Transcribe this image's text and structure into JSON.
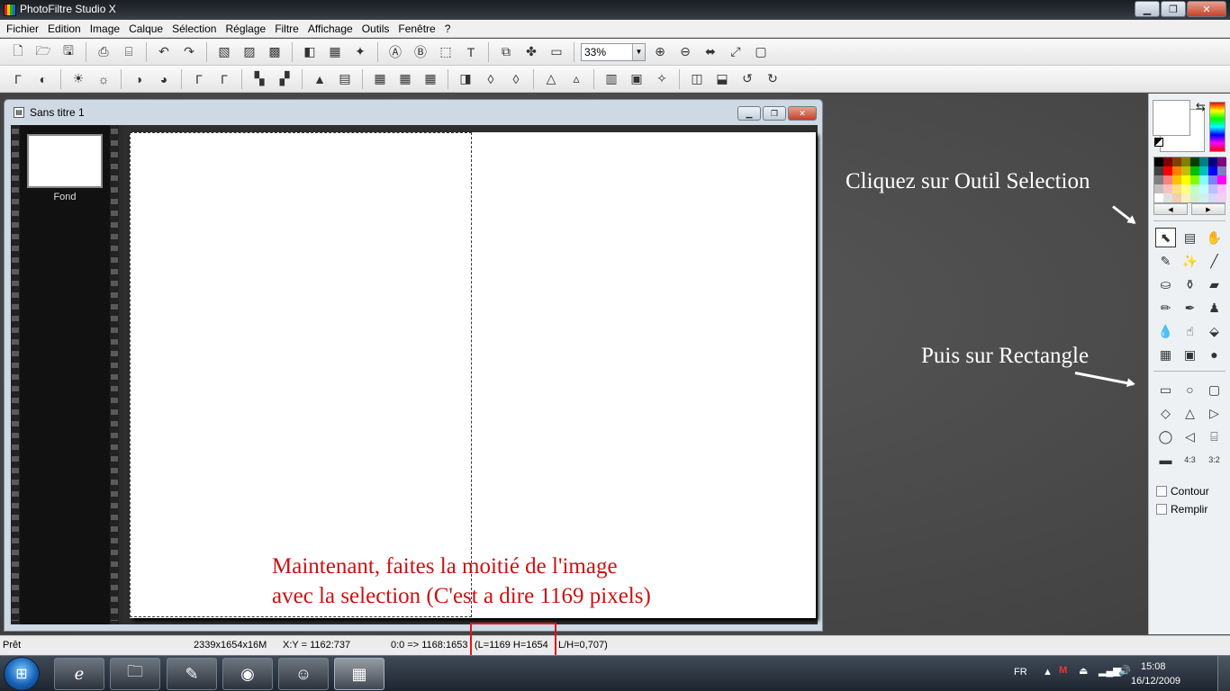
{
  "window": {
    "title": "PhotoFiltre Studio X"
  },
  "menu": [
    "Fichier",
    "Edition",
    "Image",
    "Calque",
    "Sélection",
    "Réglage",
    "Filtre",
    "Affichage",
    "Outils",
    "Fenêtre",
    "?"
  ],
  "toolbar1": {
    "zoom_value": "33%",
    "icons": [
      "new-icon",
      "open-icon",
      "save-icon",
      "|",
      "print-icon",
      "scan-icon",
      "|",
      "undo-icon",
      "redo-icon",
      "|",
      "paste-layer-icon",
      "copy-image-icon",
      "crop-icon",
      "|",
      "gradient-icon",
      "color-grid-icon",
      "filter-icon",
      "|",
      "text-frame-icon",
      "text-effect-icon",
      "select-icon",
      "text-icon",
      "|",
      "layers-icon",
      "puzzle-icon",
      "window-icon"
    ],
    "icons_after_zoom": [
      "zoom-in-icon",
      "zoom-out-icon",
      "fit-width-icon",
      "fit-image-icon",
      "fullscreen-icon"
    ]
  },
  "toolbar2": {
    "icons": [
      "auto-levels-icon",
      "auto-contrast-icon",
      "|",
      "brightness-down-icon",
      "brightness-up-icon",
      "|",
      "contrast-down-icon",
      "contrast-up-icon",
      "|",
      "gamma-down-icon",
      "gamma-up-icon",
      "|",
      "saturation-down-icon",
      "saturation-up-icon",
      "|",
      "histogram-icon",
      "rgb-icon",
      "|",
      "mosaic-1-icon",
      "mosaic-2-icon",
      "mosaic-3-icon",
      "|",
      "sharpen-icon",
      "drop-icon",
      "drops-icon",
      "|",
      "blur-icon",
      "blur-more-icon",
      "|",
      "color-bal-icon",
      "monitor-icon",
      "transform-icon",
      "|",
      "mirror-icon",
      "flip-icon",
      "rotate-left-icon",
      "rotate-right-icon"
    ]
  },
  "document": {
    "title": "Sans titre 1",
    "layer_name": "Fond",
    "note_line1": "Maintenant, faites la moitié de l'image",
    "note_line2": "avec la selection (C'est a dire 1169 pixels)"
  },
  "annotations": {
    "outil_selection": "Cliquez sur Outil Selection",
    "rectangle": "Puis sur Rectangle"
  },
  "palette": {
    "swatches": [
      "#000000",
      "#7f0000",
      "#7f3f00",
      "#7f7f00",
      "#003f00",
      "#007f7f",
      "#00007f",
      "#7f007f",
      "#3f3f3f",
      "#ff0000",
      "#ff7f00",
      "#bfbf00",
      "#00bf00",
      "#00bfbf",
      "#0000ff",
      "#7f7fbf",
      "#7f7f7f",
      "#ff7f7f",
      "#ffbf00",
      "#ffff00",
      "#7fff00",
      "#7fffff",
      "#7f7fff",
      "#ff00ff",
      "#bfbfbf",
      "#ffbfbf",
      "#ffdf7f",
      "#ffff7f",
      "#bfffbf",
      "#bfffff",
      "#bfbfff",
      "#ffbfff",
      "#ffffff",
      "#e0e0e0",
      "#f0d0b0",
      "#f8f0c0",
      "#d0f0d0",
      "#d0f0f0",
      "#d8d8f8",
      "#f0d0f0"
    ],
    "tools": [
      {
        "name": "selection-tool",
        "glyph": "⬉"
      },
      {
        "name": "frame-tool",
        "glyph": "▤"
      },
      {
        "name": "hand-tool",
        "glyph": "✋"
      },
      {
        "name": "eyedropper-tool",
        "glyph": "✎"
      },
      {
        "name": "magic-wand-tool",
        "glyph": "✨"
      },
      {
        "name": "line-tool",
        "glyph": "╱"
      },
      {
        "name": "fill-tool",
        "glyph": "⛀"
      },
      {
        "name": "spray-tool",
        "glyph": "⚱"
      },
      {
        "name": "eraser-tool",
        "glyph": "▰"
      },
      {
        "name": "brush-tool",
        "glyph": "✏"
      },
      {
        "name": "advanced-brush-tool",
        "glyph": "✒"
      },
      {
        "name": "stamp-tool",
        "glyph": "♟"
      },
      {
        "name": "blur-tool",
        "glyph": "💧"
      },
      {
        "name": "smudge-tool",
        "glyph": "☝"
      },
      {
        "name": "clone-tool",
        "glyph": "⬙"
      },
      {
        "name": "warp-tool",
        "glyph": "▦"
      },
      {
        "name": "portrait-tool",
        "glyph": "▣"
      },
      {
        "name": "strawberry-tool",
        "glyph": "●"
      }
    ],
    "shapes": [
      {
        "name": "rectangle-shape",
        "glyph": "▭"
      },
      {
        "name": "ellipse-shape",
        "glyph": "○"
      },
      {
        "name": "rounded-rect-shape",
        "glyph": "▢"
      },
      {
        "name": "diamond-shape",
        "glyph": "◇"
      },
      {
        "name": "triangle-shape",
        "glyph": "△"
      },
      {
        "name": "triangle-right-shape",
        "glyph": "▷"
      },
      {
        "name": "lasso-shape",
        "glyph": "◯"
      },
      {
        "name": "polygon-shape",
        "glyph": "◁"
      },
      {
        "name": "open-shape",
        "glyph": "⌸"
      },
      {
        "name": "ratio-free",
        "glyph": "▬"
      },
      {
        "name": "ratio-4-3",
        "glyph": "4:3"
      },
      {
        "name": "ratio-3-2",
        "glyph": "3:2"
      }
    ],
    "contour_label": "Contour",
    "remplir_label": "Remplir"
  },
  "status": {
    "ready": "Prêt",
    "size": "2339x1654x16M",
    "xy": "X:Y = 1162:737",
    "sel1": "0:0 => 1168:1653",
    "sel2": "(L=1169  H=1654",
    "ratio": "L/H=0,707)"
  },
  "taskbar": {
    "lang": "FR",
    "time": "15:08",
    "date": "16/12/2009"
  },
  "colors": {
    "annotation_red": "#cc1111",
    "highlight_red": "#e0141c"
  }
}
